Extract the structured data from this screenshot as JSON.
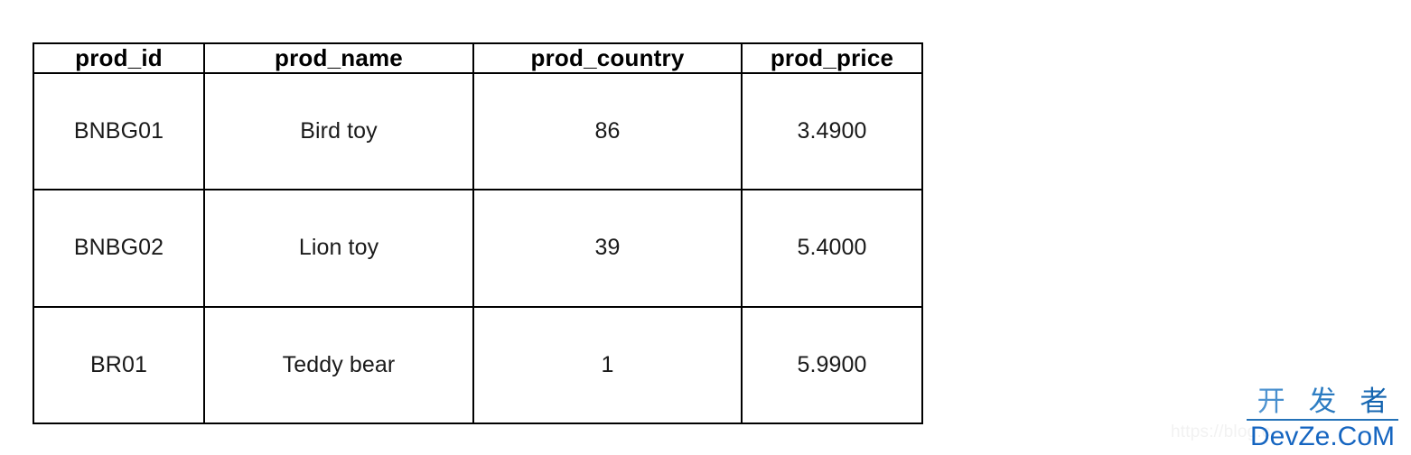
{
  "table": {
    "columns": [
      {
        "key": "prod_id",
        "label": "prod_id"
      },
      {
        "key": "prod_name",
        "label": "prod_name"
      },
      {
        "key": "prod_country",
        "label": "prod_country"
      },
      {
        "key": "prod_price",
        "label": "prod_price"
      }
    ],
    "rows": [
      {
        "prod_id": "BNBG01",
        "prod_name": "Bird toy",
        "prod_country": "86",
        "prod_price": "3.4900"
      },
      {
        "prod_id": "BNBG02",
        "prod_name": "Lion toy",
        "prod_country": "39",
        "prod_price": "5.4000"
      },
      {
        "prod_id": "BR01",
        "prod_name": "Teddy bear",
        "prod_country": "1",
        "prod_price": "5.9900"
      }
    ]
  },
  "watermark": {
    "url_text": "https://blog.c",
    "cn_text": "开 发 者",
    "en_text": "DevZe.CoM",
    "blue": "#1565c0",
    "url_gray": "#f2f2f2"
  }
}
